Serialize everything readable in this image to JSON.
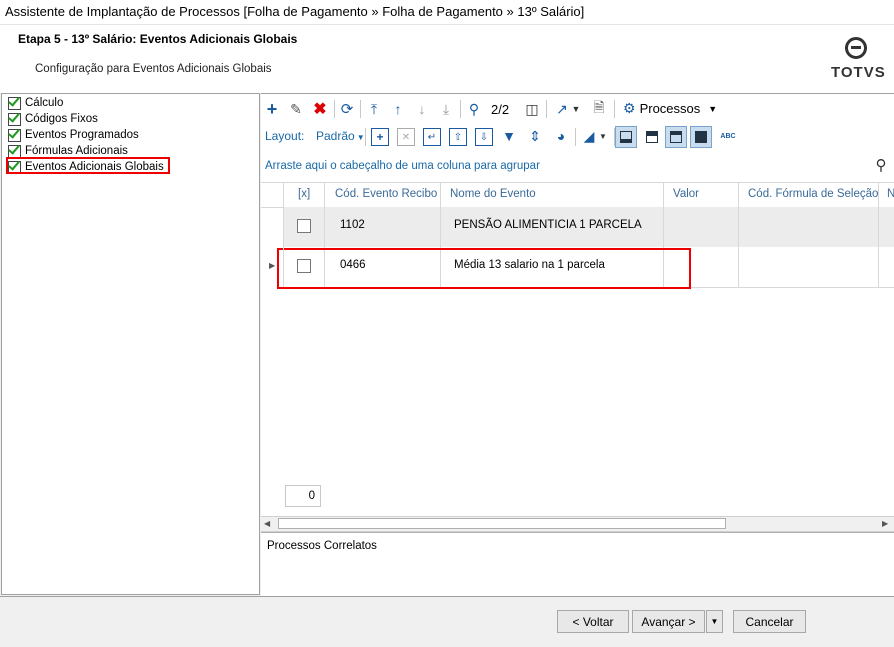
{
  "window": {
    "title": "Assistente de Implantação de Processos [Folha de Pagamento » Folha de Pagamento » 13º Salário]"
  },
  "header": {
    "step_title": "Etapa 5 - 13º Salário: Eventos Adicionais Globais",
    "subtitle": "Configuração para Eventos Adicionais Globais",
    "logo": "TOTVS"
  },
  "sidebar": {
    "items": [
      {
        "label": "Cálculo"
      },
      {
        "label": "Códigos Fixos"
      },
      {
        "label": "Eventos Programados"
      },
      {
        "label": "Fórmulas Adicionais"
      },
      {
        "label": "Eventos Adicionais Globais",
        "selected": true
      }
    ]
  },
  "toolbar": {
    "record_counter": "2/2",
    "processos_label": "Processos",
    "layout_label": "Layout:",
    "layout_value": "Padrão"
  },
  "grid": {
    "group_hint": "Arraste aqui o cabeçalho de uma coluna para agrupar",
    "columns": [
      "[x]",
      "Cód. Evento Recibo",
      "Nome do Evento",
      "Valor",
      "Cód. Fórmula de Seleção",
      "N"
    ],
    "rows": [
      {
        "code": "1102",
        "name": "PENSÃO ALIMENTICIA 1 PARCELA",
        "valor": "",
        "formula": ""
      },
      {
        "code": "0466",
        "name": "Média 13 salario na 1 parcela",
        "valor": "",
        "formula": ""
      }
    ],
    "footer_count": "0"
  },
  "correlatos": {
    "label": "Processos Correlatos"
  },
  "buttons": {
    "back": "< Voltar",
    "next": "Avançar >",
    "cancel": "Cancelar"
  },
  "colors": {
    "accent": "#1a5aa0",
    "highlight": "#e00000"
  }
}
